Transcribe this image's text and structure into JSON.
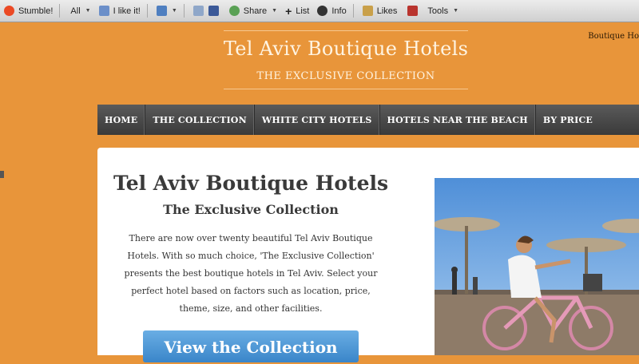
{
  "toolbar": {
    "stumble": "Stumble!",
    "all": "All",
    "ilike": "I like it!",
    "share": "Share",
    "list": "List",
    "info": "Info",
    "likes": "Likes",
    "tools": "Tools"
  },
  "site": {
    "topright": "Boutique Ho",
    "title": "Tel Aviv Boutique Hotels",
    "subtitle": "THE EXCLUSIVE COLLECTION"
  },
  "nav": [
    "HOME",
    "THE COLLECTION",
    "WHITE CITY HOTELS",
    "HOTELS NEAR THE BEACH",
    "BY PRICE"
  ],
  "main": {
    "title": "Tel Aviv Boutique Hotels",
    "subtitle": "The Exclusive Collection",
    "intro": "There are now over twenty beautiful Tel Aviv Boutique Hotels. With so much choice, 'The Exclusive Collection' presents the best boutique hotels in Tel Aviv. Select your perfect hotel based on factors such as location, price, theme, size, and other facilities.",
    "cta": "View the Collection"
  },
  "colors": {
    "page_bg": "#e8953a",
    "nav_bg": "#444444",
    "cta_bg": "#4a94d6"
  }
}
